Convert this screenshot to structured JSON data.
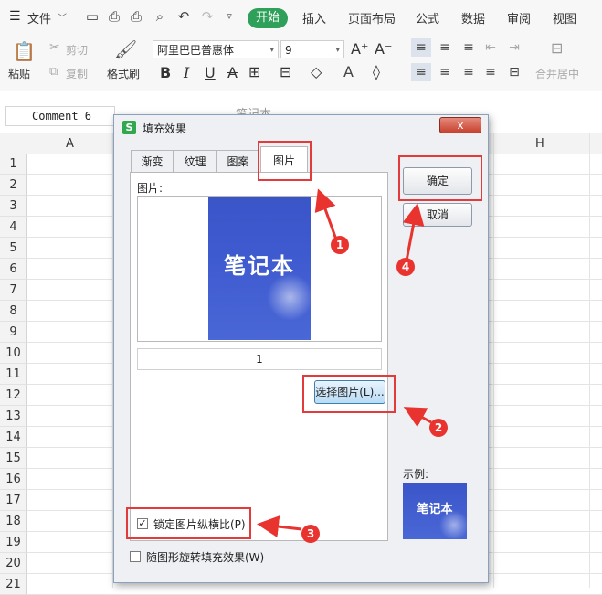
{
  "menubar": {
    "file_label": "文件",
    "items": [
      "开始",
      "插入",
      "页面布局",
      "公式",
      "数据",
      "审阅",
      "视图"
    ],
    "start_label": "开始"
  },
  "ribbon": {
    "paste": "粘贴",
    "cut": "剪切",
    "copy": "复制",
    "format_painter": "格式刷",
    "font_name": "阿里巴巴普惠体",
    "font_size": "9",
    "merge_center": "合并居中",
    "bold": "B",
    "italic": "I",
    "underline": "U"
  },
  "formula_bar": {
    "name_box": "Comment 6",
    "formula_text": "笔记本"
  },
  "sheet": {
    "columns": [
      "A",
      "H"
    ],
    "rows": [
      "1",
      "2",
      "3",
      "4",
      "5",
      "6",
      "7",
      "8",
      "9",
      "10",
      "11",
      "12",
      "13",
      "14",
      "15",
      "16",
      "17",
      "18",
      "19",
      "20",
      "21"
    ]
  },
  "dialog": {
    "title": "填充效果",
    "close_label": "x",
    "tabs": [
      "渐变",
      "纹理",
      "图案",
      "图片"
    ],
    "active_tab": "图片",
    "picture_label": "图片:",
    "picture_text": "笔记本",
    "page_value": "1",
    "select_button": "选择图片(L)...",
    "ok_button": "确定",
    "cancel_button": "取消",
    "lock_ratio_label": "锁定图片纵横比(P)",
    "lock_ratio_checked": true,
    "rotate_label": "随图形旋转填充效果(W)",
    "rotate_checked": false,
    "sample_label": "示例:",
    "sample_text": "笔记本"
  },
  "annotations": [
    "1",
    "2",
    "3",
    "4"
  ],
  "colors": {
    "accent": "#2ea05a",
    "highlight": "#e23b3b",
    "picture": "#3f5bd0"
  }
}
